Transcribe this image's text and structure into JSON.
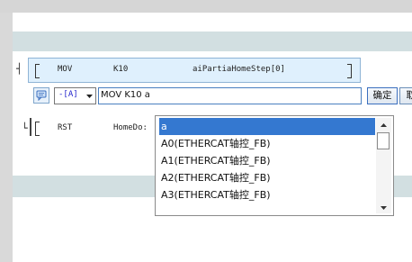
{
  "ladder": {
    "rung1": {
      "instruction": "MOV",
      "source": "K10",
      "destination": "aiPartiaHomeStep[0]"
    },
    "rung2": {
      "instruction": "RST",
      "operand": "HomeDo:"
    }
  },
  "input_bar": {
    "mode": "-[A]",
    "command_value": "MOV K10 a",
    "ok_label": "确定",
    "cancel_label": "取消"
  },
  "autocomplete": {
    "items": [
      "a",
      "A0(ETHERCAT轴控_FB)",
      "A1(ETHERCAT轴控_FB)",
      "A2(ETHERCAT轴控_FB)",
      "A3(ETHERCAT轴控_FB)"
    ],
    "selected_index": 0
  }
}
